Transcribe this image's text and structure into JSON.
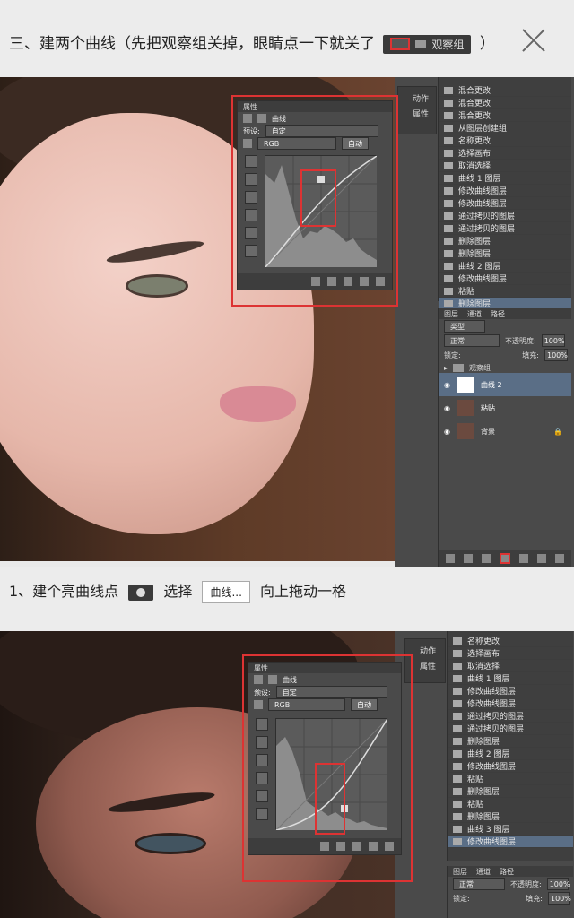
{
  "header": {
    "instruction_prefix": "三、建两个曲线（先把观察组关掉，眼睛点一下就关了",
    "chip_group_label": "观察组",
    "instruction_suffix": "）"
  },
  "screenshot1": {
    "panel_title": "属性",
    "curves_label": "曲线",
    "preset_label": "预设:",
    "preset_value": "自定",
    "channel_value": "RGB",
    "auto_label": "自动",
    "right_top_labels": [
      "动作",
      "属性"
    ],
    "history_items": [
      "混合更改",
      "混合更改",
      "混合更改",
      "从图层创建组",
      "名称更改",
      "选择画布",
      "取消选择",
      "曲线 1 图层",
      "修改曲线图层",
      "修改曲线图层",
      "通过拷贝的图层",
      "通过拷贝的图层",
      "删除图层",
      "删除图层",
      "曲线 2 图层",
      "修改曲线图层",
      "粘贴",
      "删除图层"
    ],
    "layers_tabs": [
      "图层",
      "通道",
      "路径"
    ],
    "layers_kind": "类型",
    "blend_mode": "正常",
    "opacity_label": "不透明度:",
    "opacity_value": "100%",
    "lock_label": "锁定:",
    "fill_label": "填充:",
    "fill_value": "100%",
    "layers": [
      "观察组",
      "曲线 2",
      "粘贴",
      "背景"
    ]
  },
  "step": {
    "text_prefix": "1、建个亮曲线点",
    "select_label": "选择",
    "button_label": "曲线...",
    "text_suffix": "向上拖动一格"
  },
  "screenshot2": {
    "panel_title": "属性",
    "curves_label": "曲线",
    "preset_label": "预设:",
    "preset_value": "自定",
    "channel_value": "RGB",
    "auto_label": "自动",
    "right_top_labels": [
      "动作",
      "属性"
    ],
    "history_items": [
      "名称更改",
      "选择画布",
      "取消选择",
      "曲线 1 图层",
      "修改曲线图层",
      "修改曲线图层",
      "通过拷贝的图层",
      "通过拷贝的图层",
      "删除图层",
      "曲线 2 图层",
      "修改曲线图层",
      "粘贴",
      "删除图层",
      "粘贴",
      "删除图层",
      "曲线 3 图层",
      "修改曲线图层"
    ],
    "layers_tabs": [
      "图层",
      "通道",
      "路径"
    ],
    "blend_mode": "正常",
    "opacity_label": "不透明度:",
    "opacity_value": "100%",
    "lock_label": "锁定:",
    "fill_label": "填充:",
    "fill_value": "100%"
  }
}
